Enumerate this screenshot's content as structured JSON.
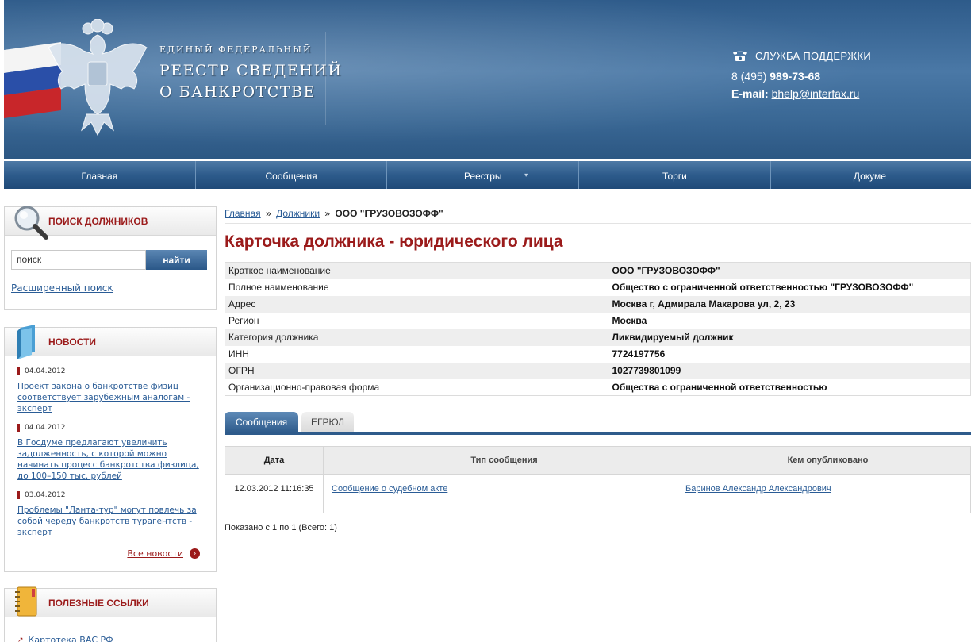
{
  "header": {
    "brand_line1": "ЕДИНЫЙ ФЕДЕРАЛЬНЫЙ",
    "brand_line2": "РЕЕСТР СВЕДЕНИЙ",
    "brand_line3": "О БАНКРОТСТВЕ",
    "support_title": "СЛУЖБА ПОДДЕРЖКИ",
    "phone_prefix": "8 (495)",
    "phone_number": "989-73-68",
    "email_label": "E-mail:",
    "email": "bhelp@interfax.ru"
  },
  "nav": {
    "items": [
      "Главная",
      "Сообщения",
      "Реестры",
      "Торги",
      "Докуме"
    ],
    "reestry_caret": "▾"
  },
  "search_box": {
    "title": "ПОИСК ДОЛЖНИКОВ",
    "input_value": "поиск",
    "button_label": "найти",
    "advanced_link": "Расширенный поиск"
  },
  "news_box": {
    "title": "НОВОСТИ",
    "items": [
      {
        "date": "04.04.2012",
        "text": "Проект закона о банкротстве физиц соответствует зарубежным аналогам - эксперт"
      },
      {
        "date": "04.04.2012",
        "text": "В Госдуме предлагают увеличить задолженность, с которой можно начинать процесс банкротства физлица, до 100–150 тыс. рублей"
      },
      {
        "date": "03.04.2012",
        "text": "Проблемы \"Ланта-тур\" могут повлечь за собой череду банкротств турагентств - эксперт"
      }
    ],
    "all_news": "Все новости",
    "all_news_arrow": "›"
  },
  "links_box": {
    "title": "ПОЛЕЗНЫЕ ССЫЛКИ",
    "first_link": "Картотека ВАС РФ",
    "link_icon": "↗"
  },
  "breadcrumb": {
    "home": "Главная",
    "sep": "»",
    "debtors": "Должники",
    "current": "ООО \"ГРУЗОВОЗОФФ\""
  },
  "page_title": "Карточка должника - юридического лица",
  "debtor_info": [
    {
      "key": "Краткое наименование",
      "value": "ООО \"ГРУЗОВОЗОФФ\""
    },
    {
      "key": "Полное наименование",
      "value": "Общество с ограниченной ответственностью \"ГРУЗОВОЗОФФ\""
    },
    {
      "key": "Адрес",
      "value": "Москва г, Адмирала Макарова ул, 2, 23"
    },
    {
      "key": "Регион",
      "value": "Москва"
    },
    {
      "key": "Категория должника",
      "value": "Ликвидируемый должник"
    },
    {
      "key": "ИНН",
      "value": "7724197756"
    },
    {
      "key": "ОГРН",
      "value": "1027739801099"
    },
    {
      "key": "Организационно-правовая форма",
      "value": "Общества с ограниченной ответственностью"
    }
  ],
  "tabs": {
    "messages": "Сообщения",
    "egrul": "ЕГРЮЛ"
  },
  "messages_table": {
    "headers": [
      "Дата",
      "Тип сообщения",
      "Кем опубликовано"
    ],
    "rows": [
      {
        "date": "12.03.2012 11:16:35",
        "type": "Сообщение о судебном акте",
        "publisher": "Баринов Александр Александрович"
      }
    ]
  },
  "pagination_text": "Показано с 1 по 1 (Всего: 1)",
  "colors": {
    "header_blue": "#3a6895",
    "accent_red": "#9b1b1b",
    "link_blue": "#2a5c96"
  }
}
